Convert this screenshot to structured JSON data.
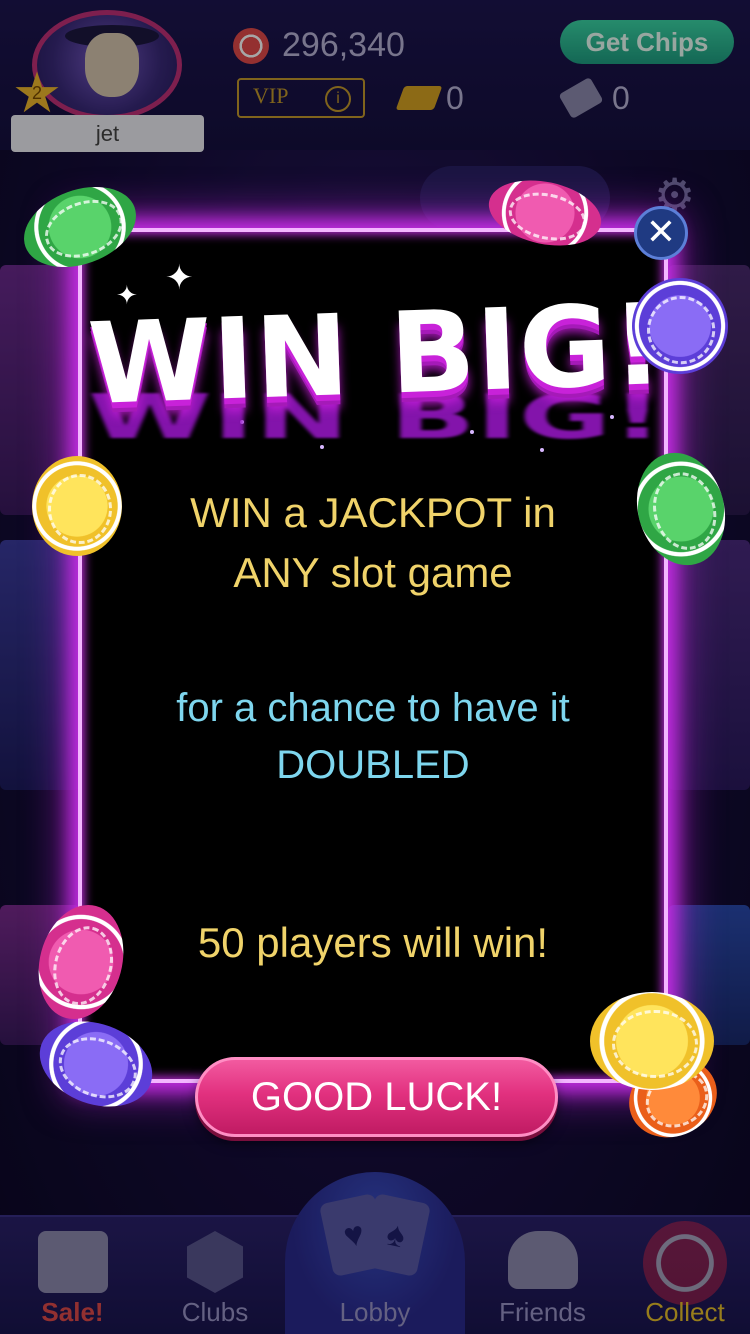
{
  "header": {
    "player_level": "2",
    "player_name": "jet",
    "chip_balance": "296,340",
    "get_chips_label": "Get Chips",
    "vip_label": "VIP",
    "vip_info_icon": "i",
    "gold_count": "0",
    "ticket_count": "0"
  },
  "popup": {
    "headline": "WIN BIG!",
    "line1": "WIN a JACKPOT in",
    "line2": "ANY slot game",
    "line3": "for a chance to have it",
    "line4": "DOUBLED",
    "line5": "50 players will win!",
    "cta_label": "GOOD LUCK!",
    "close_symbol": "✕"
  },
  "bottom_nav": {
    "sale": "Sale!",
    "clubs": "Clubs",
    "lobby": "Lobby",
    "friends": "Friends",
    "collect": "Collect"
  },
  "colors": {
    "popup_glow": "#c42de3",
    "primary_text": "#f0d36a",
    "secondary_text": "#7ed6ee",
    "cta": "#e2317f"
  },
  "icons": [
    "star-icon",
    "chip-icon",
    "gold-bar-icon",
    "ticket-icon",
    "mail-icon",
    "gear-icon",
    "close-icon",
    "shopping-bag-icon",
    "hexagon-icon",
    "cards-icon",
    "friends-icon",
    "chip-collect-icon"
  ]
}
